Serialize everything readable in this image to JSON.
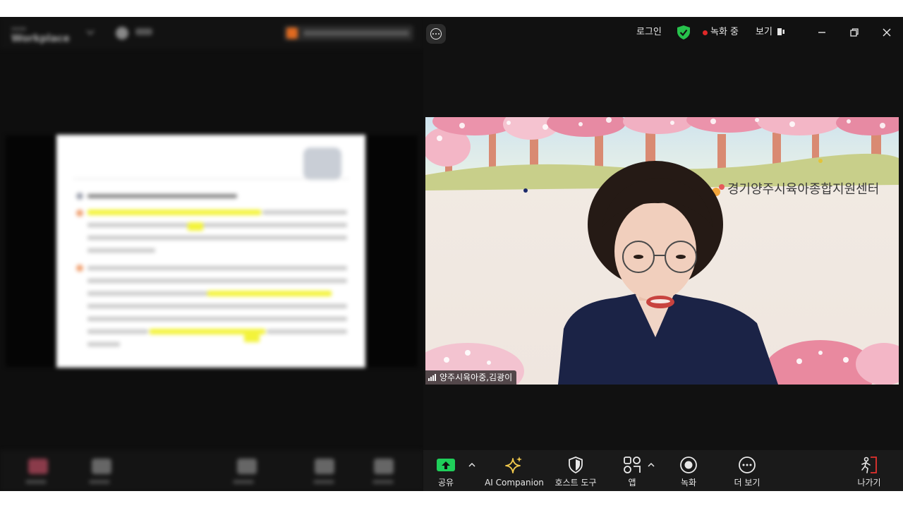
{
  "left_pane": {
    "description_visible": "blurred screen share window"
  },
  "topbar": {
    "login_label": "로그인",
    "recording_label": "녹화 중",
    "view_label": "보기"
  },
  "video": {
    "participant_name": "양주시육아중,김광이",
    "banner_text": "경기양주시육아종합지원센터"
  },
  "toolbar": {
    "share_label": "공유",
    "ai_label": "AI Companion",
    "host_tools_label": "호스트 도구",
    "apps_label": "앱",
    "record_label": "녹화",
    "more_label": "더 보기",
    "leave_label": "나가기"
  },
  "colors": {
    "share_green": "#1fcf5a",
    "ai_gold": "#f2c94c",
    "shield_green": "#27c24c",
    "rec_red": "#e02828",
    "leave_red": "#e5322e"
  }
}
